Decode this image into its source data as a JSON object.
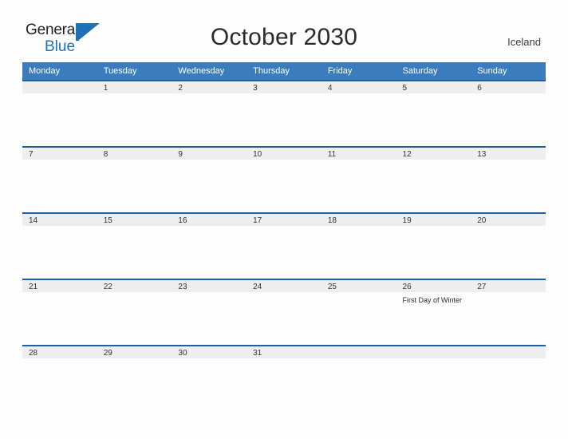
{
  "brand": {
    "name_part1": "General",
    "name_part2": "Blue",
    "logo_icon": "flag-triangle-icon"
  },
  "header": {
    "title": "October 2030",
    "country": "Iceland"
  },
  "colors": {
    "header_blue": "#3a7cbe",
    "row_rule_blue": "#1f5fa0",
    "date_strip_gray": "#eeeeee",
    "brand_blue": "#1f6fb7",
    "page_background": "#fdfdfd"
  },
  "calendar": {
    "weekday_headers": [
      "Monday",
      "Tuesday",
      "Wednesday",
      "Thursday",
      "Friday",
      "Saturday",
      "Sunday"
    ],
    "weeks": [
      [
        {
          "day": "",
          "events": []
        },
        {
          "day": "1",
          "events": []
        },
        {
          "day": "2",
          "events": []
        },
        {
          "day": "3",
          "events": []
        },
        {
          "day": "4",
          "events": []
        },
        {
          "day": "5",
          "events": []
        },
        {
          "day": "6",
          "events": []
        }
      ],
      [
        {
          "day": "7",
          "events": []
        },
        {
          "day": "8",
          "events": []
        },
        {
          "day": "9",
          "events": []
        },
        {
          "day": "10",
          "events": []
        },
        {
          "day": "11",
          "events": []
        },
        {
          "day": "12",
          "events": []
        },
        {
          "day": "13",
          "events": []
        }
      ],
      [
        {
          "day": "14",
          "events": []
        },
        {
          "day": "15",
          "events": []
        },
        {
          "day": "16",
          "events": []
        },
        {
          "day": "17",
          "events": []
        },
        {
          "day": "18",
          "events": []
        },
        {
          "day": "19",
          "events": []
        },
        {
          "day": "20",
          "events": []
        }
      ],
      [
        {
          "day": "21",
          "events": []
        },
        {
          "day": "22",
          "events": []
        },
        {
          "day": "23",
          "events": []
        },
        {
          "day": "24",
          "events": []
        },
        {
          "day": "25",
          "events": []
        },
        {
          "day": "26",
          "events": [
            "First Day of Winter"
          ]
        },
        {
          "day": "27",
          "events": []
        }
      ],
      [
        {
          "day": "28",
          "events": []
        },
        {
          "day": "29",
          "events": []
        },
        {
          "day": "30",
          "events": []
        },
        {
          "day": "31",
          "events": []
        },
        {
          "day": "",
          "events": []
        },
        {
          "day": "",
          "events": []
        },
        {
          "day": "",
          "events": []
        }
      ]
    ]
  }
}
